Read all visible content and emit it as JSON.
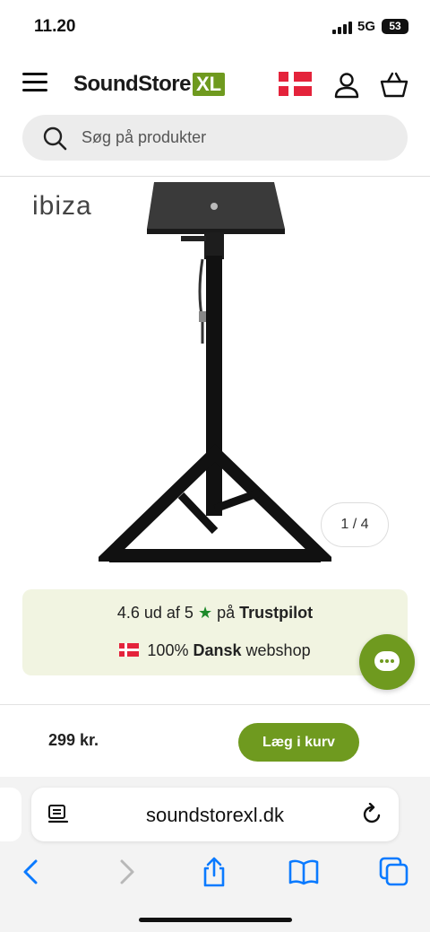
{
  "status": {
    "time": "11.20",
    "network": "5G",
    "battery": "53"
  },
  "header": {
    "logo_word": "SoundStore",
    "logo_badge": "XL"
  },
  "search": {
    "placeholder": "Søg på produkter"
  },
  "gallery": {
    "brand": "ibiza",
    "pager": "1 / 4"
  },
  "trust": {
    "rating": "4.6 ud af 5",
    "star": "★",
    "on": "på",
    "platform": "Trustpilot",
    "percent": "100%",
    "dansk": "Dansk",
    "webshop": "webshop"
  },
  "buy": {
    "price": "299 kr.",
    "add_to_cart": "Læg i kurv"
  },
  "browser": {
    "url": "soundstorexl.dk"
  },
  "colors": {
    "brand_green": "#6f9a1f",
    "flag_red": "#e4233b",
    "trust_bg": "#f1f4e1",
    "ios_blue": "#0a7aff"
  }
}
